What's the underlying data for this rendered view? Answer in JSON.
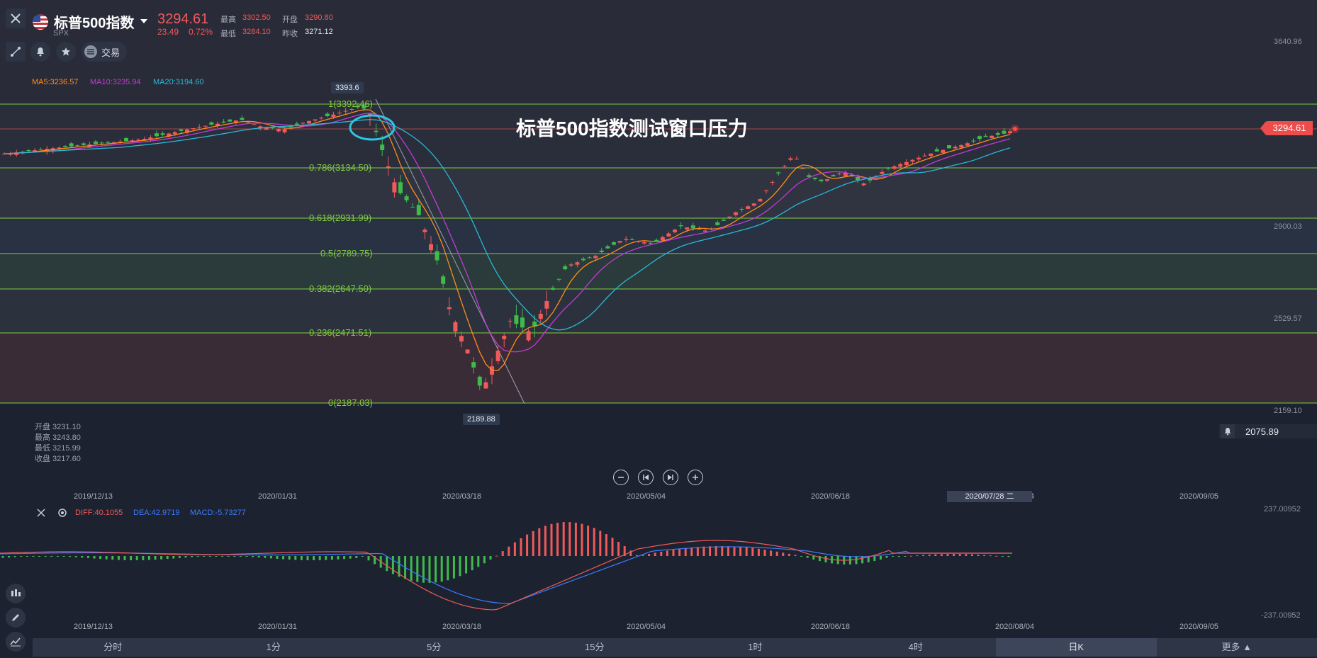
{
  "header": {
    "title": "标普500指数",
    "code": "SPX",
    "price": "3294.61",
    "change": "23.49",
    "change_pct": "0.72%",
    "high_label": "最高",
    "high": "3302.50",
    "open_label": "开盘",
    "open": "3290.80",
    "low_label": "最低",
    "low": "3284.10",
    "prev_close_label": "昨收",
    "prev_close": "3271.12"
  },
  "toolbar": {
    "trade_label": "交易"
  },
  "ma": {
    "ma5": "MA5:3236.57",
    "ma10": "MA10:3235.94",
    "ma20": "MA20:3194.60"
  },
  "chart_annotation": "标普500指数测试窗口压力",
  "hover_ohlc": {
    "open": "开盘 3231.10",
    "high": "最高 3243.80",
    "low": "最低 3215.99",
    "close": "收盘 3217.60"
  },
  "price_axis": {
    "ticks": [
      "3640.96",
      "2900.03",
      "2529.57",
      "2159.10"
    ],
    "current_price_tag": "3294.61",
    "alert_price": "2075.89"
  },
  "peak_label": "3393.6",
  "trough_label": "2189.88",
  "fibonacci": [
    {
      "label": "1(3392.46)",
      "value": 3392.46
    },
    {
      "label": "0.786(3134.50)",
      "value": 3134.5
    },
    {
      "label": "0.618(2931.99)",
      "value": 2931.99
    },
    {
      "label": "0.5(2789.75)",
      "value": 2789.75
    },
    {
      "label": "0.382(2647.50)",
      "value": 2647.5
    },
    {
      "label": "0.236(2471.51)",
      "value": 2471.51
    },
    {
      "label": "0(2187.03)",
      "value": 2187.03
    }
  ],
  "dates": [
    "2019/12/13",
    "2020/01/31",
    "2020/03/18",
    "2020/05/04",
    "2020/06/18",
    "2020/08/04",
    "2020/09/05"
  ],
  "crosshair_date": "2020/07/28 二",
  "macd": {
    "diff": "DIFF:40.1055",
    "dea": "DEA:42.9719",
    "macd": "MACD:-5.73277",
    "axis_top": "237.00952",
    "axis_bottom": "-237.00952"
  },
  "periods": [
    "分时",
    "1分",
    "5分",
    "15分",
    "1时",
    "4时",
    "日K",
    "更多"
  ],
  "active_period": "日K",
  "colors": {
    "up": "#f05a5a",
    "down": "#3fbb4c",
    "ma5": "#ff8c1a",
    "ma10": "#c23ad6",
    "ma20": "#28b9d6",
    "fib": "#7fcd3f",
    "diff": "#f05a5a",
    "dea": "#3b7bff"
  }
}
